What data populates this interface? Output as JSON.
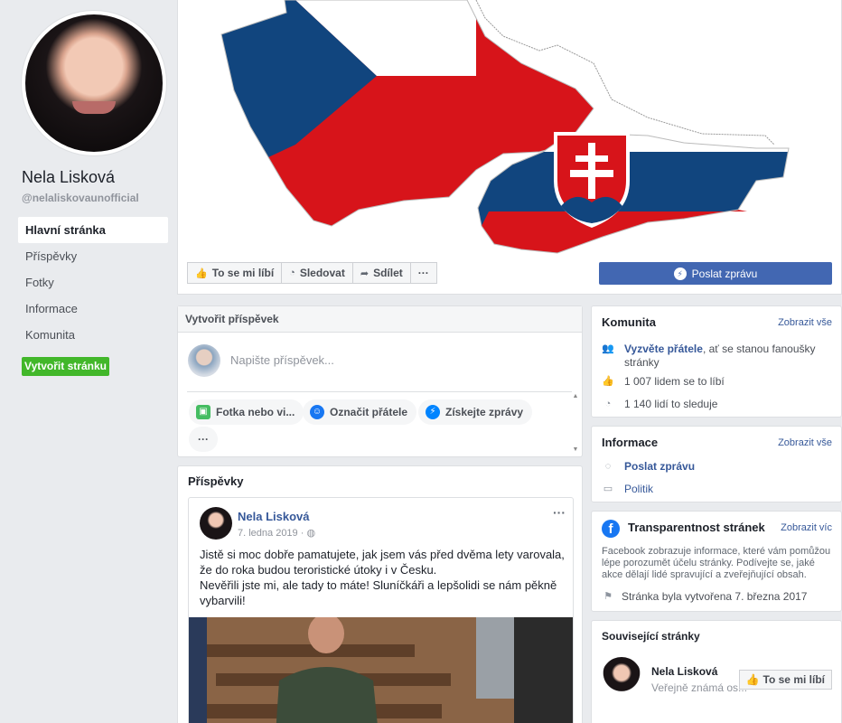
{
  "profile": {
    "name": "Nela Lisková",
    "handle": "@nelaliskovaunofficial"
  },
  "nav": {
    "items": [
      {
        "label": "Hlavní stránka",
        "active": true
      },
      {
        "label": "Příspěvky"
      },
      {
        "label": "Fotky"
      },
      {
        "label": "Informace"
      },
      {
        "label": "Komunita"
      }
    ],
    "create_page": "Vytvořit stránku"
  },
  "cover_actions": {
    "like": "To se mi líbí",
    "follow": "Sledovat",
    "share": "Sdílet",
    "more": "···",
    "send_message": "Poslat zprávu"
  },
  "composer": {
    "title": "Vytvořit příspěvek",
    "placeholder": "Napište příspěvek...",
    "options": [
      "Fotka nebo vi...",
      "Označit přátele",
      "Získejte zprávy"
    ],
    "more": "···"
  },
  "posts": {
    "title": "Příspěvky",
    "items": [
      {
        "author": "Nela Lisková",
        "date": "7. ledna 2019 ·",
        "more": "···",
        "text_lines": [
          "Jistě si moc dobře pamatujete, jak jsem vás před dvěma lety varovala,",
          "že do roka budou teroristické útoky i v Česku.",
          "Nevěřili jste mi, ale tady to máte! Sluníčkáři a lepšolidi se nám pěkně",
          "vybarvili!"
        ]
      }
    ]
  },
  "community": {
    "title": "Komunita",
    "see_all": "Zobrazit vše",
    "invite_link": "Vyzvěte přátele",
    "invite_rest": ", ať se stanou fanoušky stránky",
    "likes": "1 007 lidem se to líbí",
    "follows": "1 140 lidí to sleduje"
  },
  "info": {
    "title": "Informace",
    "see_all": "Zobrazit vše",
    "send_message": "Poslat zprávu",
    "category": "Politik"
  },
  "transparency": {
    "title": "Transparentnost stránek",
    "see_more": "Zobrazit víc",
    "description": "Facebook zobrazuje informace, které vám pomůžou lépe porozumět účelu stránky. Podívejte se, jaké akce dělají lidé spravující a zveřejňující obsah.",
    "created": "Stránka byla vytvořena 7. března 2017"
  },
  "related": {
    "title": "Související stránky",
    "items": [
      {
        "name": "Nela Lisková",
        "subtitle": "Veřejně známá os...",
        "like": "To se mi líbí"
      }
    ]
  },
  "colors": {
    "fb_blue": "#4267b2",
    "link_blue": "#365899",
    "green": "#42b72a",
    "czech_red": "#d7141a",
    "czech_blue": "#11457e"
  },
  "icons": {
    "like": "thumbs-up-icon",
    "follow": "rss-icon",
    "share": "share-arrow-icon",
    "messenger": "messenger-icon"
  }
}
